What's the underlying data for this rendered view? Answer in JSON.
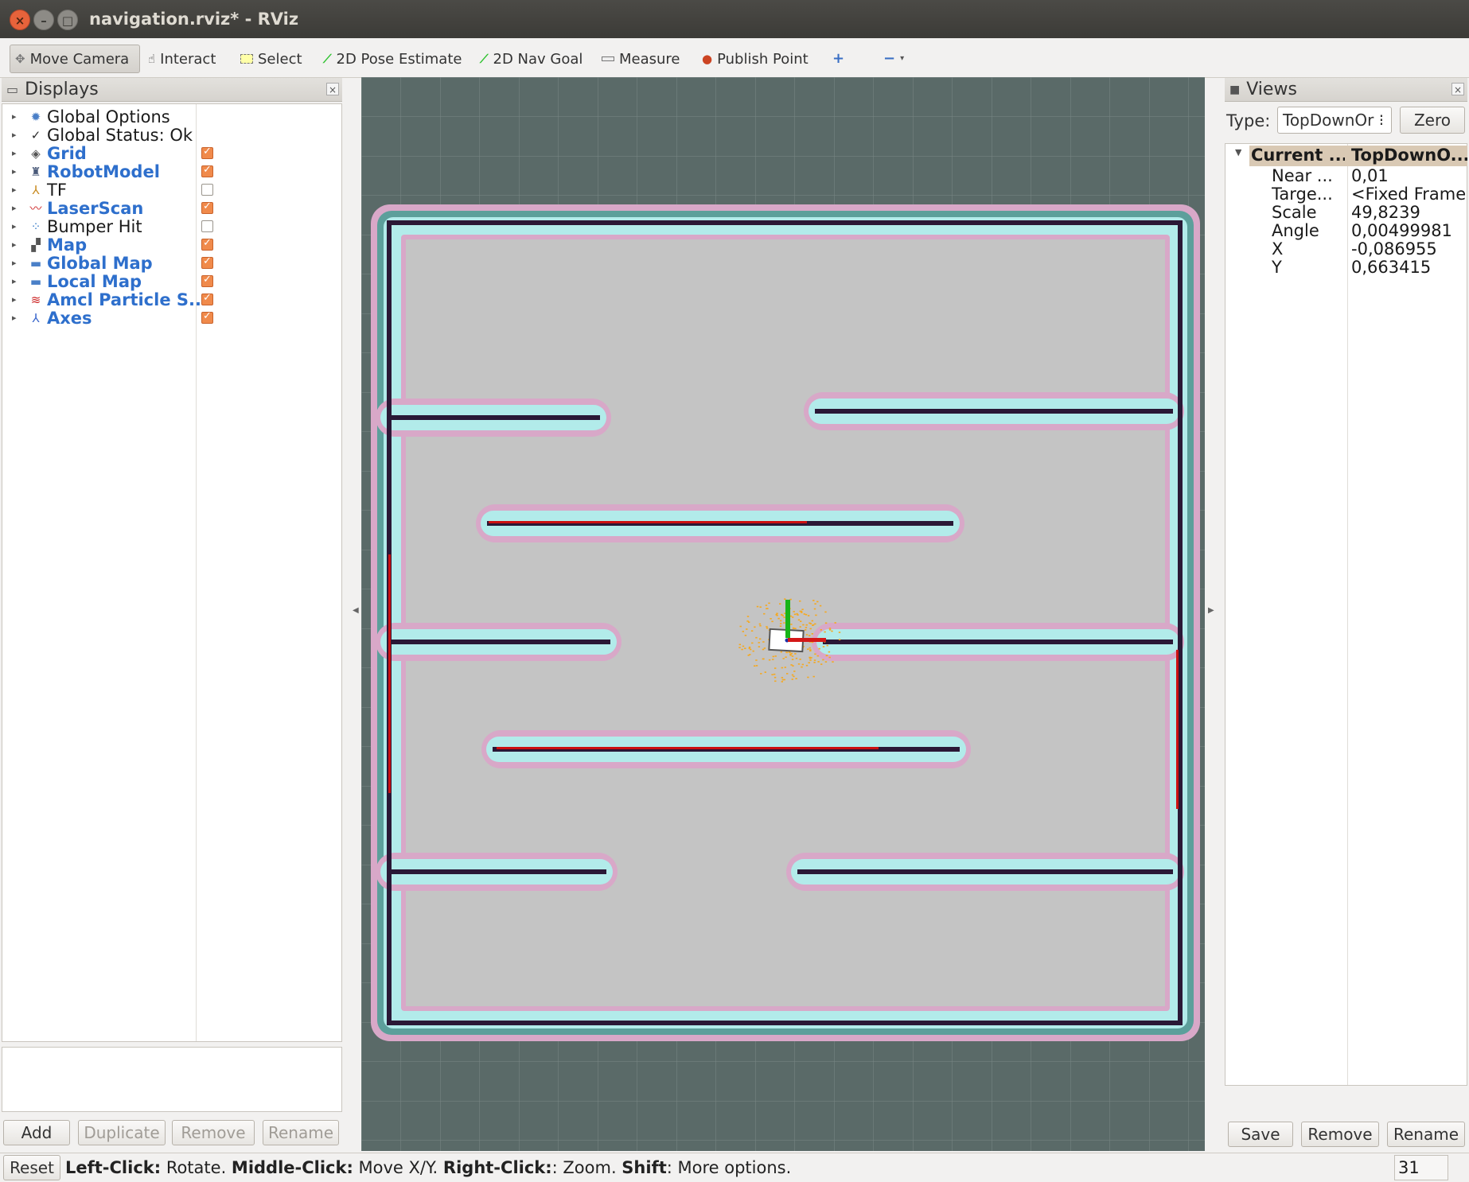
{
  "window": {
    "title": "navigation.rviz* - RViz"
  },
  "toolbar": {
    "tools": [
      {
        "label": "Move Camera",
        "icon": "move-camera-icon"
      },
      {
        "label": "Interact",
        "icon": "hand-icon"
      },
      {
        "label": "Select",
        "icon": "select-box-icon"
      },
      {
        "label": "2D Pose Estimate",
        "icon": "green-arrow-icon"
      },
      {
        "label": "2D Nav Goal",
        "icon": "green-arrow-icon"
      },
      {
        "label": "Measure",
        "icon": "ruler-icon"
      },
      {
        "label": "Publish Point",
        "icon": "pin-icon"
      }
    ],
    "add_tool_icon": "plus-icon",
    "remove_tool_icon": "minus-icon"
  },
  "displays": {
    "title": "Displays",
    "items": [
      {
        "label": "Global Options",
        "icon": "gear-icon",
        "checkbox": null,
        "highlight": false
      },
      {
        "label": "Global Status: Ok",
        "icon": "checkmark-icon",
        "checkbox": null,
        "highlight": false
      },
      {
        "label": "Grid",
        "icon": "grid-icon",
        "checkbox": true,
        "highlight": true
      },
      {
        "label": "RobotModel",
        "icon": "robot-icon",
        "checkbox": true,
        "highlight": true
      },
      {
        "label": "TF",
        "icon": "tf-axes-icon",
        "checkbox": false,
        "highlight": false
      },
      {
        "label": "LaserScan",
        "icon": "laser-icon",
        "checkbox": true,
        "highlight": true
      },
      {
        "label": "Bumper Hit",
        "icon": "dots-icon",
        "checkbox": false,
        "highlight": false
      },
      {
        "label": "Map",
        "icon": "map-icon",
        "checkbox": true,
        "highlight": true
      },
      {
        "label": "Global Map",
        "icon": "folder-icon",
        "checkbox": true,
        "highlight": true
      },
      {
        "label": "Local Map",
        "icon": "folder-icon",
        "checkbox": true,
        "highlight": true
      },
      {
        "label": "Amcl Particle S...",
        "icon": "particles-icon",
        "checkbox": true,
        "highlight": true
      },
      {
        "label": "Axes",
        "icon": "axes-icon",
        "checkbox": true,
        "highlight": true
      }
    ],
    "buttons": {
      "add": "Add",
      "duplicate": "Duplicate",
      "remove": "Remove",
      "rename": "Rename"
    }
  },
  "views": {
    "title": "Views",
    "type_label": "Type:",
    "type_value": "TopDownOr ⁝",
    "zero_button": "Zero",
    "current_label": "Current ...",
    "current_value": "TopDownO...",
    "properties": [
      {
        "name": "Near ...",
        "value": "0,01"
      },
      {
        "name": "Targe...",
        "value": "<Fixed Frame>"
      },
      {
        "name": "Scale",
        "value": "49,8239"
      },
      {
        "name": "Angle",
        "value": "0,00499981"
      },
      {
        "name": "X",
        "value": "-0,086955"
      },
      {
        "name": "Y",
        "value": "0,663415"
      }
    ],
    "buttons": {
      "save": "Save",
      "remove": "Remove",
      "rename": "Rename"
    }
  },
  "statusbar": {
    "reset": "Reset",
    "hint_parts": [
      {
        "text": "Left-Click:",
        "bold": true
      },
      {
        "text": " Rotate. ",
        "bold": false
      },
      {
        "text": "Middle-Click:",
        "bold": true
      },
      {
        "text": " Move X/Y. ",
        "bold": false
      },
      {
        "text": "Right-Click:",
        "bold": true
      },
      {
        "text": ": Zoom. ",
        "bold": false
      },
      {
        "text": "Shift",
        "bold": true
      },
      {
        "text": ": More options.",
        "bold": false
      }
    ],
    "fps": "31 fps"
  },
  "colors": {
    "background": "#5a6a68",
    "free_space": "#c4c4c4",
    "inflation_cyan": "#b2ebea",
    "inflation_teal": "#5c9f9b",
    "inflation_pink": "#d8a8c8",
    "wall": "#2a1836",
    "laser": "#cc1111",
    "particles": "#f5a81f"
  }
}
